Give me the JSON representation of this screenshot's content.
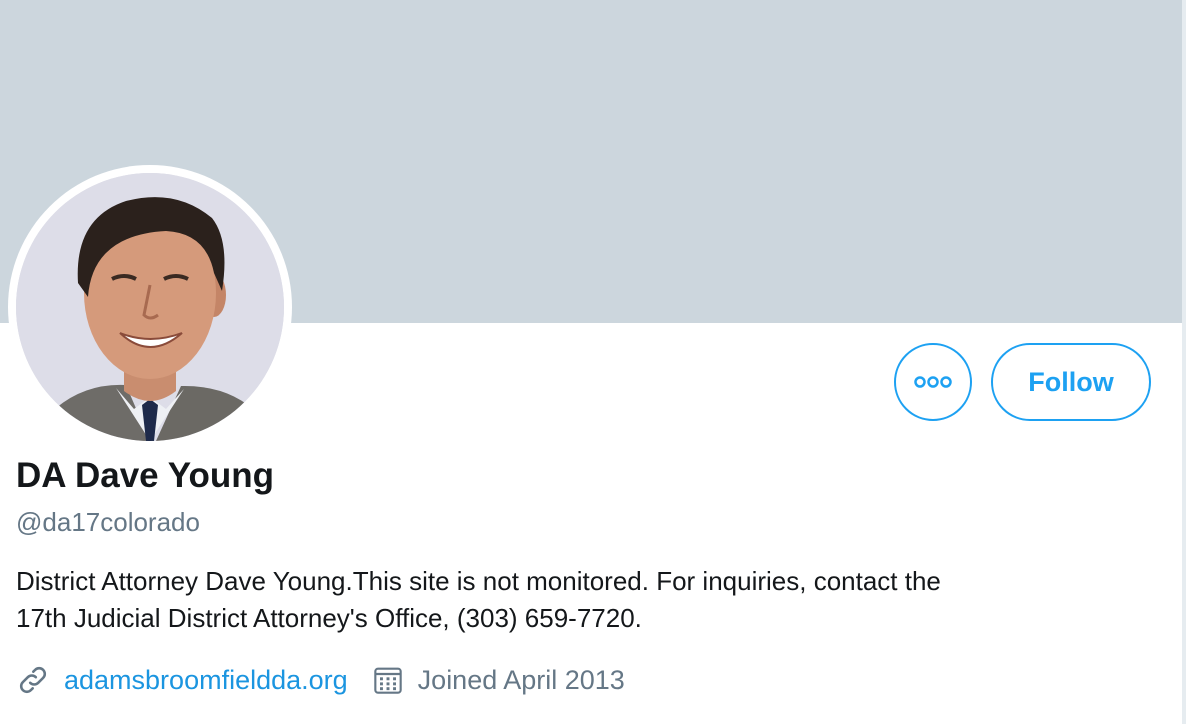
{
  "profile": {
    "display_name": "DA Dave Young",
    "handle": "@da17colorado",
    "bio_line1": "District Attorney Dave Young.This site is not monitored. For inquiries, contact the",
    "bio_line2": "17th Judicial District Attorney's Office, (303) 659-7720.",
    "website": "adamsbroomfieldda.org",
    "joined": "Joined April 2013"
  },
  "actions": {
    "follow_label": "Follow",
    "more_icon": "more-icon"
  },
  "icons": {
    "link": "link-icon",
    "calendar": "calendar-icon"
  },
  "colors": {
    "accent": "#1da1f2",
    "banner": "#ccd6dd",
    "secondary_text": "#657786",
    "primary_text": "#14171a"
  }
}
